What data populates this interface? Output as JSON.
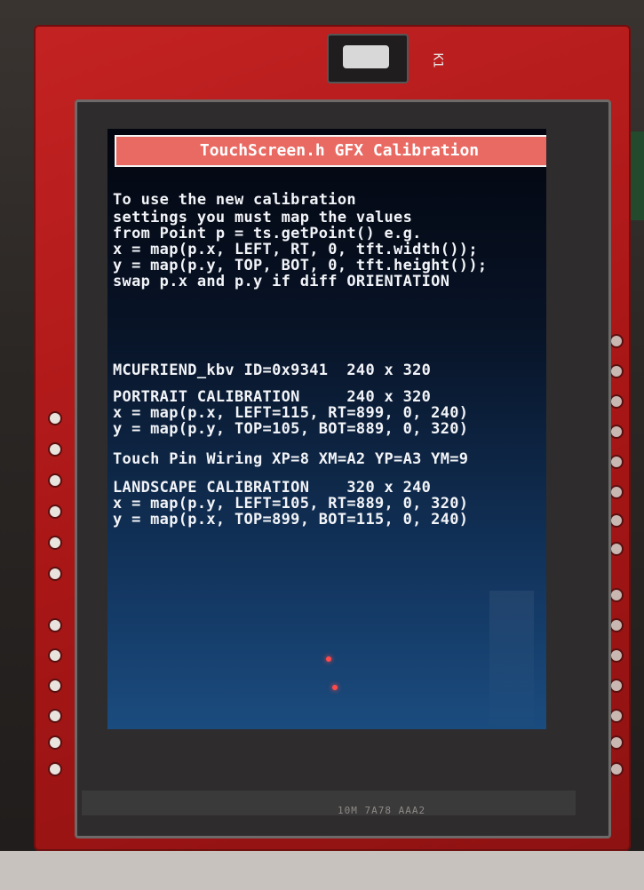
{
  "device": {
    "title_bar": "TouchScreen.h GFX Calibration",
    "silk_label": "K1",
    "bottom_code": "10M 7A78    AAA2"
  },
  "screen_text": {
    "instructions": [
      "To use the new calibration",
      "settings you must map the values",
      "from Point p = ts.getPoint() e.g.",
      "x = map(p.x, LEFT, RT, 0, tft.width());",
      "y = map(p.y, TOP, BOT, 0, tft.height());",
      "swap p.x and p.y if diff ORIENTATION"
    ],
    "id_line": "MCUFRIEND_kbv ID=0x9341  240 x 320",
    "portrait": [
      "PORTRAIT CALIBRATION     240 x 320",
      "x = map(p.x, LEFT=115, RT=899, 0, 240)",
      "y = map(p.y, TOP=105, BOT=889, 0, 320)"
    ],
    "wiring": "Touch Pin Wiring XP=8 XM=A2 YP=A3 YM=9",
    "landscape": [
      "LANDSCAPE CALIBRATION    320 x 240",
      "x = map(p.y, LEFT=105, RT=889, 0, 320)",
      "y = map(p.x, TOP=899, BOT=115, 0, 240)"
    ]
  },
  "colors": {
    "pcb_red": "#b31818",
    "title_bar_bg": "#e96a63",
    "screen_text": "#f2f4f8",
    "screen_dark": "#03060f",
    "screen_blue": "#1b4c7f"
  }
}
